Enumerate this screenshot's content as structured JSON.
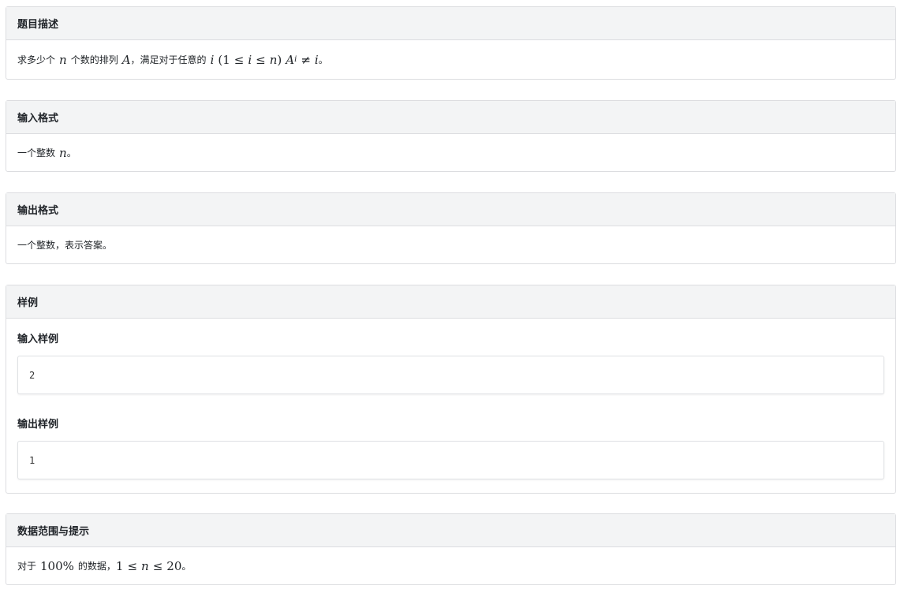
{
  "problem": {
    "title": "题目描述",
    "t1": "求多少个",
    "n1": "n",
    "t2": "个数的排列",
    "A1": "A",
    "t3": "，满足对于任意的",
    "i1": "i",
    "p_open": "(1",
    "le1": "≤",
    "i2": "i",
    "le2": "≤",
    "n2": "n",
    "p_close": ")",
    "A2": "A",
    "sub_i": "i",
    "neq": "≠",
    "i3": "i",
    "end": "。"
  },
  "input_format": {
    "title": "输入格式",
    "t1": "一个整数",
    "n": "n",
    "end": "。"
  },
  "output_format": {
    "title": "输出格式",
    "text": "一个整数，表示答案。"
  },
  "samples": {
    "title": "样例",
    "input_label": "输入样例",
    "input_value": "2",
    "output_label": "输出样例",
    "output_value": "1"
  },
  "hint": {
    "title": "数据范围与提示",
    "t1": "对于",
    "pct": "100%",
    "t2": "的数据，",
    "one": "1",
    "le1": "≤",
    "n": "n",
    "le2": "≤",
    "twenty": "20",
    "end": "。"
  }
}
